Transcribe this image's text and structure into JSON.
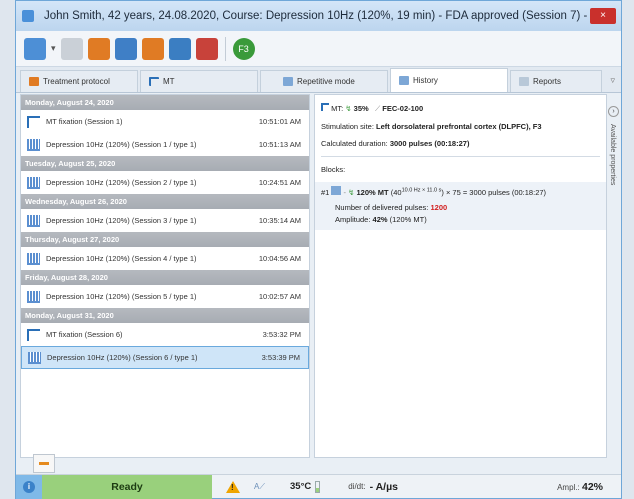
{
  "window": {
    "title": "John Smith, 42 years, 24.08.2020, Course: Depression 10Hz (120%, 19 min) - FDA approved (Session 7) - ...",
    "close_label": "×"
  },
  "toolbar": {
    "buttons": [
      "patient-icon",
      "disabled-icon",
      "course-icon",
      "export-icon",
      "import-icon",
      "delete-icon",
      "f3-icon"
    ],
    "f3_label": "F3"
  },
  "tabs": [
    {
      "label": "Treatment protocol"
    },
    {
      "label": "MT"
    },
    {
      "label": "Repetitive mode"
    },
    {
      "label": "History"
    },
    {
      "label": "Reports"
    }
  ],
  "history": {
    "groups": [
      {
        "date": "Monday, August 24, 2020",
        "items": [
          {
            "type": "fix",
            "label": "MT fixation (Session 1)",
            "time": "10:51:01 AM"
          },
          {
            "type": "dep",
            "label": "Depression 10Hz (120%) (Session 1 / type 1)",
            "time": "10:51:13 AM"
          }
        ]
      },
      {
        "date": "Tuesday, August 25, 2020",
        "items": [
          {
            "type": "dep",
            "label": "Depression 10Hz (120%) (Session 2 / type 1)",
            "time": "10:24:51 AM"
          }
        ]
      },
      {
        "date": "Wednesday, August 26, 2020",
        "items": [
          {
            "type": "dep",
            "label": "Depression 10Hz (120%) (Session 3 / type 1)",
            "time": "10:35:14 AM"
          }
        ]
      },
      {
        "date": "Thursday, August 27, 2020",
        "items": [
          {
            "type": "dep",
            "label": "Depression 10Hz (120%) (Session 4 / type 1)",
            "time": "10:04:56 AM"
          }
        ]
      },
      {
        "date": "Friday, August 28, 2020",
        "items": [
          {
            "type": "dep",
            "label": "Depression 10Hz (120%) (Session 5 / type 1)",
            "time": "10:02:57 AM"
          }
        ]
      },
      {
        "date": "Monday, August 31, 2020",
        "items": [
          {
            "type": "fix",
            "label": "MT fixation (Session 6)",
            "time": "3:53:32 PM"
          },
          {
            "type": "dep",
            "label": "Depression 10Hz (120%) (Session 6 / type 1)",
            "time": "3:53:39 PM",
            "selected": true
          }
        ]
      }
    ]
  },
  "details": {
    "mt_label": "MT:",
    "mt_value": "35%",
    "coil": "FEC-02-100",
    "site_label": "Stimulation site:",
    "site_value": "Left dorsolateral prefrontal cortex (DLPFC), F3",
    "duration_label": "Calculated duration:",
    "duration_value": "3000 pulses (00:18:27)",
    "blocks_label": "Blocks:",
    "block_num": "#1",
    "block_mt": "120% MT",
    "block_formula_pre": "(40",
    "block_formula_sup": "10.0 Hz × 11.0 s",
    "block_formula_post": ") × 75 = 3000 pulses (00:18:27)",
    "delivered_label": "Number of delivered pulses:",
    "delivered_value": "1200",
    "amplitude_label": "Amplitude:",
    "amplitude_value": "42%",
    "amplitude_note": "(120% MT)"
  },
  "side_panel": {
    "label": "Available properties",
    "expand": "›"
  },
  "status": {
    "ready": "Ready",
    "temp": "35°C",
    "didt_label": "di/dt:",
    "didt_value": "- A/µs",
    "ampl_label": "Ampl.:",
    "ampl_value": "42%"
  },
  "colors": {
    "ready_bg": "#99d07c",
    "selected_row": "#cfe5f8",
    "delivered_red": "#d21f1f",
    "date_header": "#aeb3b9"
  }
}
